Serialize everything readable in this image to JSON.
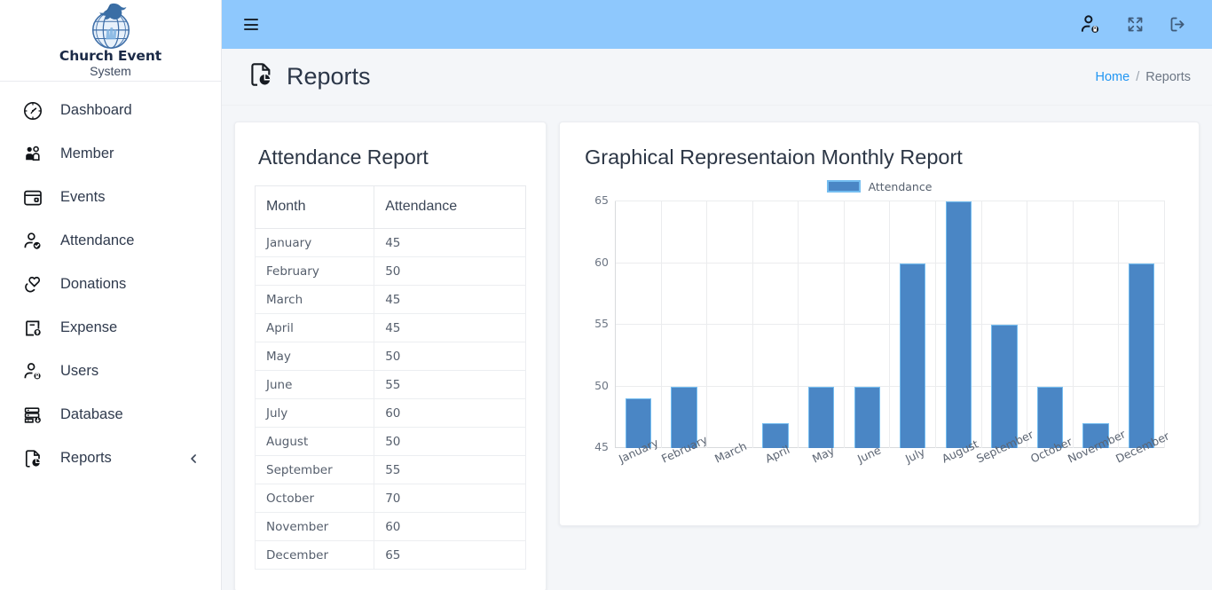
{
  "brand": {
    "logo_icon": "dove-globe-logo",
    "line1": "Church Event",
    "line2": "System"
  },
  "sidebar": {
    "items": [
      {
        "label": "Dashboard",
        "icon": "gauge-icon",
        "active": false,
        "caret": false
      },
      {
        "label": "Member",
        "icon": "users-group-icon",
        "active": false,
        "caret": false
      },
      {
        "label": "Events",
        "icon": "calendar-card-icon",
        "active": false,
        "caret": false
      },
      {
        "label": "Attendance",
        "icon": "user-check-icon",
        "active": false,
        "caret": false
      },
      {
        "label": "Donations",
        "icon": "hand-heart-icon",
        "active": false,
        "caret": false
      },
      {
        "label": "Expense",
        "icon": "receipt-dollar-icon",
        "active": false,
        "caret": false
      },
      {
        "label": "Users",
        "icon": "user-lock-icon",
        "active": false,
        "caret": false
      },
      {
        "label": "Database",
        "icon": "database-down-icon",
        "active": false,
        "caret": false
      },
      {
        "label": "Reports",
        "icon": "file-chart-icon",
        "active": true,
        "caret": true
      }
    ],
    "caret_icon": "chevron-left-icon"
  },
  "topbar": {
    "background": "#8ec8fd",
    "menu_icon": "hamburger-icon",
    "actions": [
      {
        "icon": "user-lock-icon",
        "name": "profile-lock-button"
      },
      {
        "icon": "fullscreen-icon",
        "name": "fullscreen-button"
      },
      {
        "icon": "logout-icon",
        "name": "logout-button"
      }
    ]
  },
  "pagehead": {
    "icon": "file-chart-icon",
    "title": "Reports",
    "breadcrumb": {
      "home": "Home",
      "separator": "/",
      "current": "Reports"
    }
  },
  "attendance_card": {
    "title": "Attendance Report",
    "columns": [
      "Month",
      "Attendance"
    ],
    "rows": [
      {
        "month": "January",
        "attendance": "45"
      },
      {
        "month": "February",
        "attendance": "50"
      },
      {
        "month": "March",
        "attendance": "45"
      },
      {
        "month": "April",
        "attendance": "45"
      },
      {
        "month": "May",
        "attendance": "50"
      },
      {
        "month": "June",
        "attendance": "55"
      },
      {
        "month": "July",
        "attendance": "60"
      },
      {
        "month": "August",
        "attendance": "50"
      },
      {
        "month": "September",
        "attendance": "55"
      },
      {
        "month": "October",
        "attendance": "70"
      },
      {
        "month": "November",
        "attendance": "60"
      },
      {
        "month": "December",
        "attendance": "65"
      }
    ]
  },
  "chart_card": {
    "title": "Graphical Representaion Monthly Report"
  },
  "chart_data": {
    "type": "bar",
    "title": "Graphical Representaion Monthly Report",
    "xlabel": "",
    "ylabel": "",
    "ylim": [
      45,
      65
    ],
    "yticks": [
      45,
      50,
      55,
      60,
      65
    ],
    "grid": true,
    "legend_position": "top-center",
    "series": [
      {
        "name": "Attendance",
        "color": "#4a86c5",
        "border_color": "#74bdf0",
        "values": [
          49,
          50,
          45,
          47,
          50,
          50,
          60,
          65,
          55,
          50,
          47,
          60
        ]
      }
    ],
    "categories": [
      "January",
      "February",
      "March",
      "April",
      "May",
      "June",
      "July",
      "August",
      "September",
      "October",
      "Novermber",
      "December"
    ]
  },
  "theme": {
    "header_blue": "#8ec8fd",
    "content_bg": "#f4f6f9",
    "accent_link": "#2196f3",
    "bar_fill": "#4a86c5",
    "bar_border": "#74bdf0"
  }
}
